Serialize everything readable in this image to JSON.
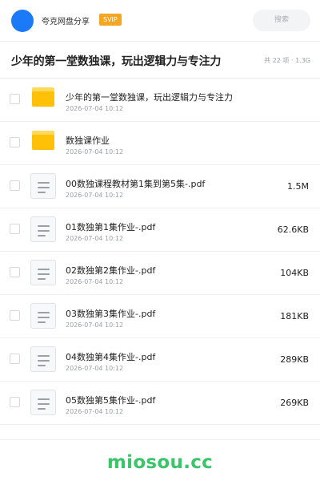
{
  "header": {
    "share_name": "夸克网盘分享",
    "vip_badge": "SVIP",
    "search_placeholder": "搜索"
  },
  "folder": {
    "title": "少年的第一堂数独课，玩出逻辑力与专注力",
    "meta": "共 22 项 · 1.3G"
  },
  "files": [
    {
      "name": "少年的第一堂数独课，玩出逻辑力与专注力",
      "date": "2026-07-04 10:12",
      "size": "",
      "type": "folder"
    },
    {
      "name": "数独课作业",
      "date": "2026-07-04 10:12",
      "size": "",
      "type": "folder"
    },
    {
      "name": "00数独课程教材第1集到第5集-.pdf",
      "date": "2026-07-04 10:12",
      "size": "1.5M",
      "type": "file"
    },
    {
      "name": "01数独第1集作业-.pdf",
      "date": "2026-07-04 10:12",
      "size": "62.6KB",
      "type": "file"
    },
    {
      "name": "02数独第2集作业-.pdf",
      "date": "2026-07-04 10:12",
      "size": "104KB",
      "type": "file"
    },
    {
      "name": "03数独第3集作业-.pdf",
      "date": "2026-07-04 10:12",
      "size": "181KB",
      "type": "file"
    },
    {
      "name": "04数独第4集作业-.pdf",
      "date": "2026-07-04 10:12",
      "size": "289KB",
      "type": "file"
    },
    {
      "name": "05数独第5集作业-.pdf",
      "date": "2026-07-04 10:12",
      "size": "269KB",
      "type": "file"
    }
  ],
  "footer": {
    "watermark": "miosou.cc"
  },
  "colors": {
    "avatar": "#1a7af8",
    "vip_badge": "#f5a623",
    "folder": "#ffc107",
    "watermark": "#3cc46b"
  }
}
